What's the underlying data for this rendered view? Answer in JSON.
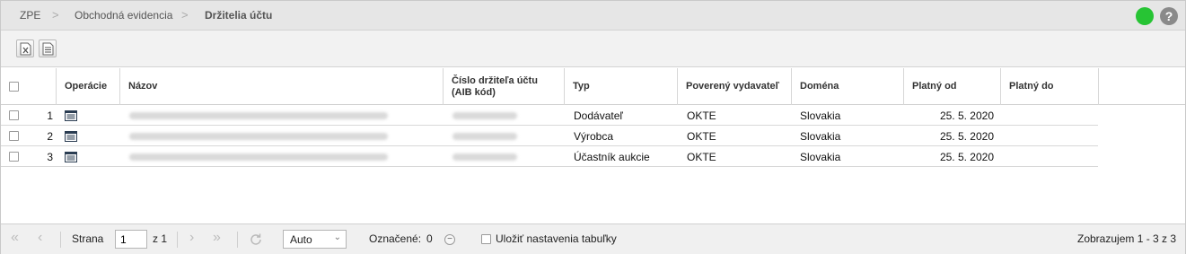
{
  "breadcrumb": {
    "items": [
      "ZPE",
      "Obchodná evidencia",
      "Držitelia účtu"
    ],
    "separator": ">"
  },
  "status": {
    "color": "#27c434"
  },
  "help": {
    "label": "?"
  },
  "toolbar": {
    "buttons": [
      {
        "icon": "excel-export-icon"
      },
      {
        "icon": "document-export-icon"
      }
    ]
  },
  "table": {
    "columns": [
      "",
      "Operácie",
      "Názov",
      "Číslo držiteľa účtu\n(AIB kód)",
      "Typ",
      "Poverený vydavateľ",
      "Doména",
      "Platný od",
      "Platný do"
    ],
    "rows": [
      {
        "num": "1",
        "typ": "Dodávateľ",
        "vydavatel": "OKTE",
        "domena": "Slovakia",
        "platny_od": "25. 5. 2020",
        "platny_do": ""
      },
      {
        "num": "2",
        "typ": "Výrobca",
        "vydavatel": "OKTE",
        "domena": "Slovakia",
        "platny_od": "25. 5. 2020",
        "platny_do": ""
      },
      {
        "num": "3",
        "typ": "Účastník aukcie",
        "vydavatel": "OKTE",
        "domena": "Slovakia",
        "platny_od": "25. 5. 2020",
        "platny_do": ""
      }
    ]
  },
  "pager": {
    "page_label": "Strana",
    "page_value": "1",
    "of_label": "z 1",
    "size_value": "Auto",
    "marked_label": "Označené:",
    "marked_count": "0",
    "save_label": "Uložiť nastavenia tabuľky",
    "display_info": "Zobrazujem 1 - 3 z 3"
  }
}
